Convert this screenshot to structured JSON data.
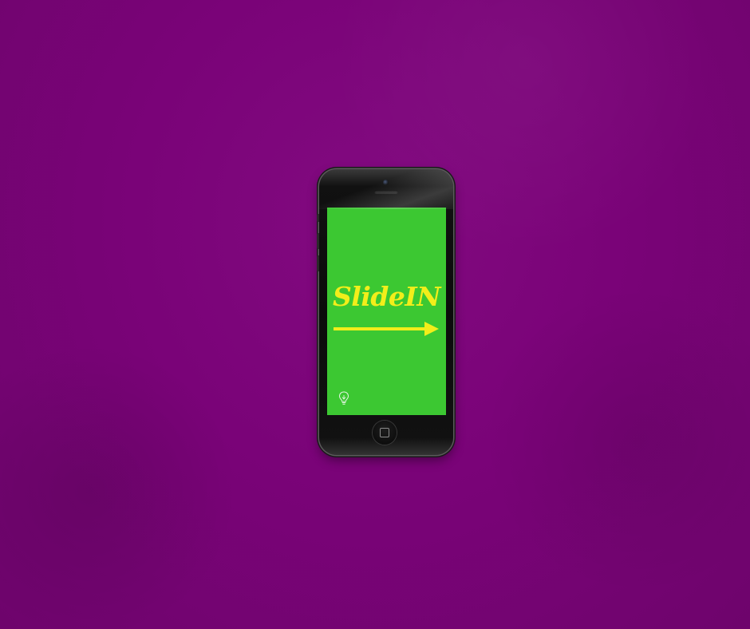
{
  "colors": {
    "background": "#7a0378",
    "screen": "#3cc832",
    "accent": "#f2ee1a",
    "phone_body": "#0b0b0b"
  },
  "phone": {
    "screen": {
      "title": "SlideIN",
      "arrow_icon": "right-arrow-icon",
      "corner_icon": "lightbulb-icon"
    },
    "home_button_icon": "home-button-icon"
  }
}
